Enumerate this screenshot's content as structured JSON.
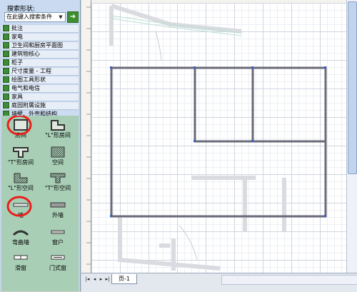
{
  "search": {
    "label": "搜索形状:",
    "placeholder": "在此键入搜索条件",
    "go_icon": "arrow-right-icon"
  },
  "stencils": [
    {
      "label": "批注"
    },
    {
      "label": "家电"
    },
    {
      "label": "卫生间和厨房平面图"
    },
    {
      "label": "建筑物核心"
    },
    {
      "label": "柜子"
    },
    {
      "label": "尺寸度量 - 工程"
    },
    {
      "label": "绘图工具形状"
    },
    {
      "label": "电气和电信"
    },
    {
      "label": "家具"
    },
    {
      "label": "庭园附属设施"
    },
    {
      "label": "墙壁、外壳和结构"
    }
  ],
  "shapes": [
    {
      "label": "房间",
      "icon": "room-icon"
    },
    {
      "label": "\"L\"形房间",
      "icon": "l-room-icon"
    },
    {
      "label": "\"T\"形房间",
      "icon": "t-room-icon"
    },
    {
      "label": "空间",
      "icon": "space-icon"
    },
    {
      "label": "\"L\"形空间",
      "icon": "l-space-icon"
    },
    {
      "label": "\"T\"形空间",
      "icon": "t-space-icon"
    },
    {
      "label": "墙",
      "icon": "wall-icon"
    },
    {
      "label": "外墙",
      "icon": "exterior-wall-icon"
    },
    {
      "label": "弯曲墙",
      "icon": "curved-wall-icon"
    },
    {
      "label": "窗户",
      "icon": "window-icon"
    },
    {
      "label": "滑窗",
      "icon": "sliding-window-icon"
    },
    {
      "label": "门式窗",
      "icon": "door-window-icon"
    }
  ],
  "page_tab": "页-1",
  "nav_icons": [
    "first-page-icon",
    "prev-page-icon",
    "next-page-icon",
    "last-page-icon"
  ],
  "colors": {
    "highlight_circle": "#e8201c",
    "wall": "#6a6a78",
    "accent_green": "#3c8f2e"
  }
}
